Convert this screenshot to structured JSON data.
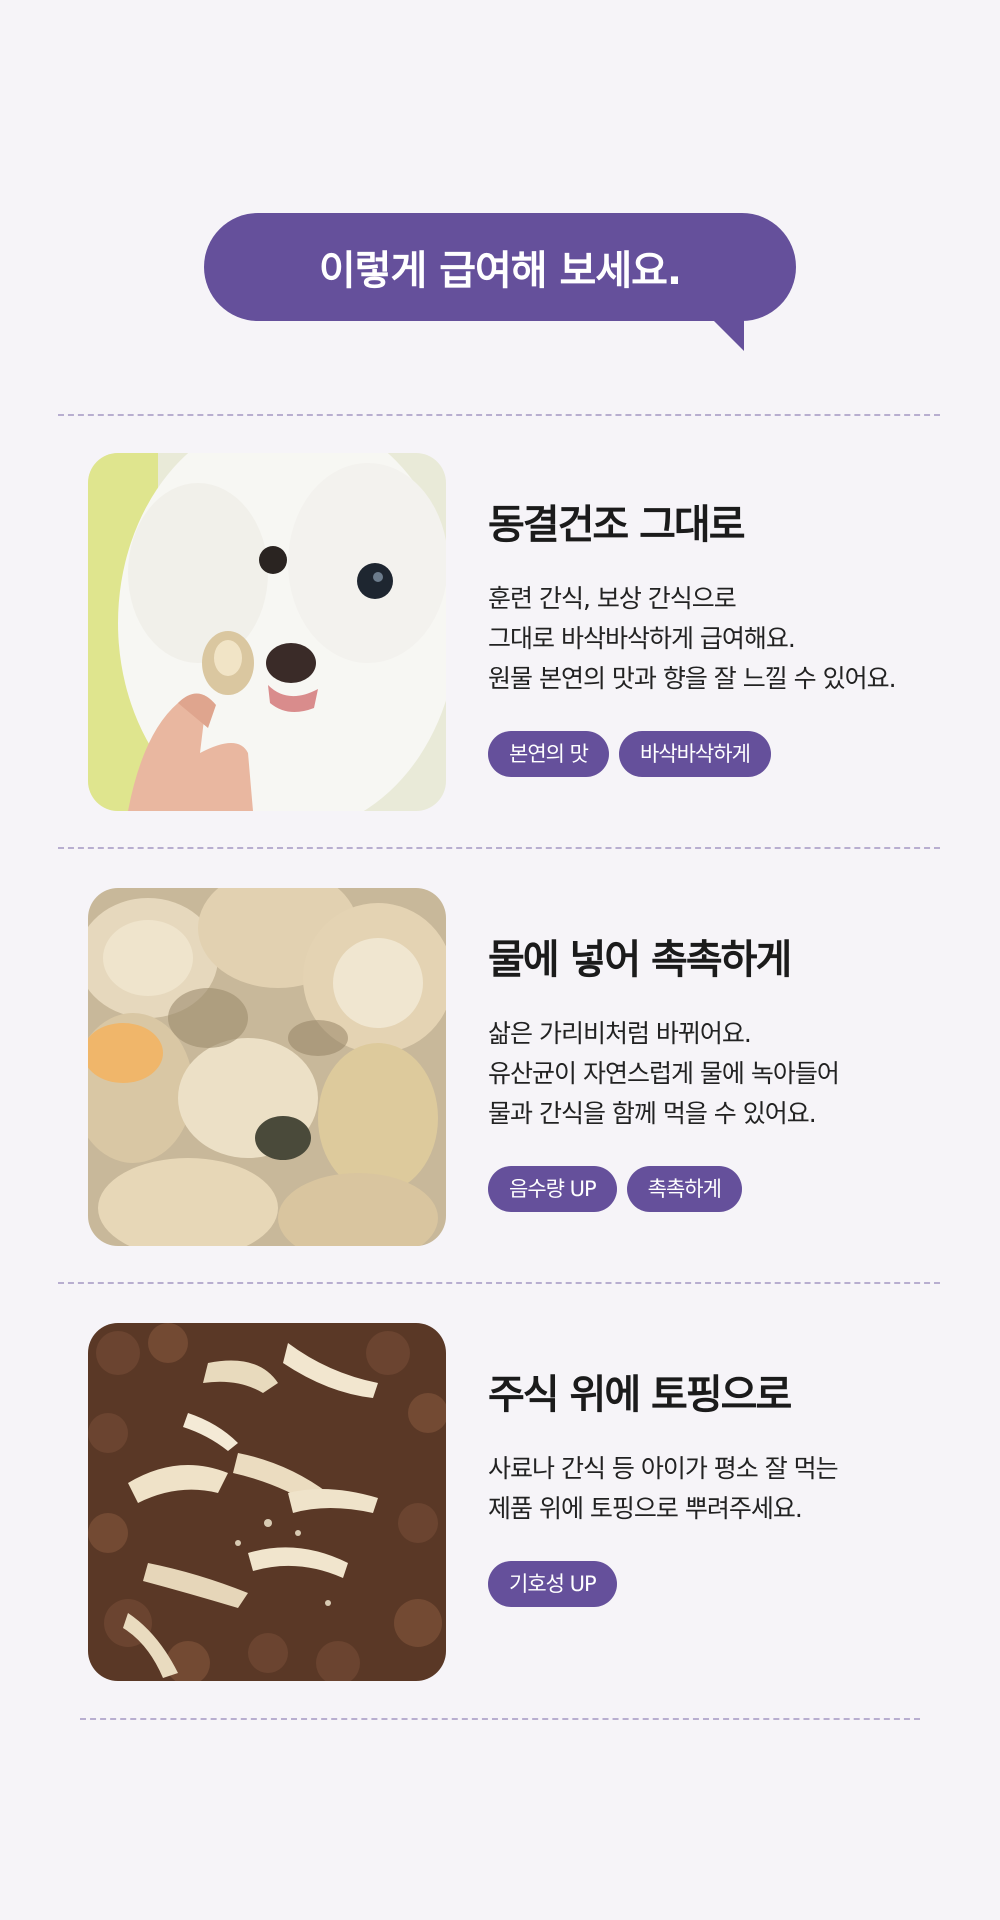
{
  "header": {
    "bubble_text": "이렇게 급여해 보세요."
  },
  "sections": [
    {
      "title": "동결건조 그대로",
      "desc": [
        "훈련 간식, 보상 간식으로",
        "그대로 바삭바삭하게 급여해요.",
        "원물 본연의 맛과 향을 잘 느낄 수 있어요."
      ],
      "tags": [
        "본연의 맛",
        "바삭바삭하게"
      ]
    },
    {
      "title": "물에 넣어 촉촉하게",
      "desc": [
        "삶은 가리비처럼 바뀌어요.",
        "유산균이 자연스럽게 물에 녹아들어",
        "물과 간식을 함께 먹을 수 있어요."
      ],
      "tags": [
        "음수량 UP",
        "촉촉하게"
      ]
    },
    {
      "title": "주식 위에 토핑으로",
      "desc": [
        "사료나 간식 등 아이가 평소 잘 먹는",
        "제품 위에 토핑으로 뿌려주세요."
      ],
      "tags": [
        "기호성 UP"
      ]
    }
  ],
  "colors": {
    "accent": "#65509b",
    "background": "#f6f4f8",
    "divider": "#b8aed0"
  }
}
